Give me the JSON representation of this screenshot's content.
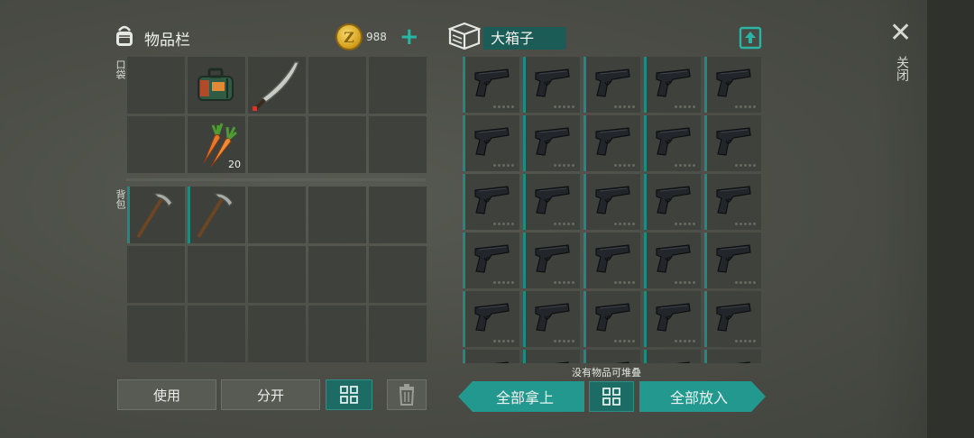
{
  "inventory": {
    "title": "物品栏",
    "coins": "988",
    "pocket_label": "口袋",
    "backpack_label": "背包",
    "items": {
      "carrot_count": "20"
    }
  },
  "container": {
    "name": "大箱子"
  },
  "hint": "没有物品可堆叠",
  "buttons": {
    "use": "使用",
    "split": "分开",
    "take_all": "全部拿上",
    "put_all": "全部放入",
    "close": "关闭"
  },
  "colors": {
    "accent": "#23988e",
    "accent_dark": "#1c6b64",
    "slot": "#3f413c",
    "coin": "#d9a623"
  },
  "icons": {
    "backpack": "backpack-icon",
    "coin": "coin-icon",
    "chest": "chest-icon",
    "share": "upload-icon",
    "sort": "grid-sort-icon",
    "trash": "trash-icon",
    "close": "close-icon",
    "pistol": "pistol-icon"
  }
}
